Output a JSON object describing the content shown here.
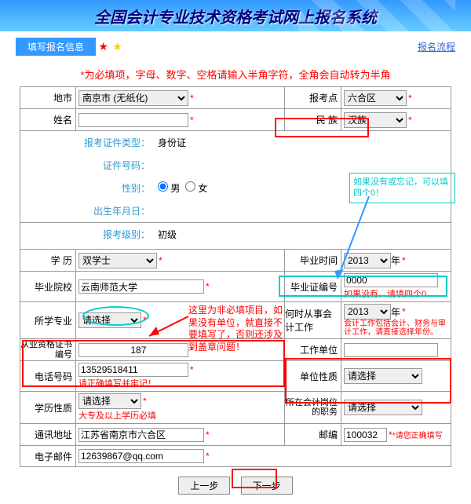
{
  "banner": {
    "title": "全国会计专业技术资格考试网上报名系统"
  },
  "breadcrumb": {
    "label": "填写报名信息",
    "process_link": "报名流程"
  },
  "instruction": "*为必填项，字母、数字、空格请输入半角字符，全角会自动转为半角",
  "form": {
    "region_label": "地市",
    "region_value": "南京市 (无纸化)",
    "exam_point_label": "报考点",
    "exam_point_value": "六合区",
    "name_label": "姓名",
    "name_value": "",
    "ethnic_label": "民 族",
    "ethnic_value": "汉族",
    "id_type_label": "报考证件类型：",
    "id_type_value": "身份证",
    "id_no_label": "证件号码：",
    "id_no_value": "",
    "gender_label": "性别：",
    "gender_m": "男",
    "gender_f": "女",
    "birth_label": "出生年月日：",
    "birth_value": "",
    "exam_level_label": "报考级别：",
    "exam_level_value": "初级",
    "education_label": "学 历",
    "education_value": "双学士",
    "grad_time_label": "毕业时间",
    "grad_time_value": "2013",
    "grad_time_unit": "年",
    "school_label": "毕业院校",
    "school_value": "云南师范大学",
    "cert_no_label": "毕业证编号",
    "cert_no_value": "0000",
    "cert_no_tip": "如果没有，请填四个0",
    "major_label": "所学专业",
    "major_value": "请选择",
    "work_time_label": "何时从事会计工作",
    "work_time_value": "2013",
    "work_time_unit": "年",
    "work_time_tip": "会计工作包括会计、财务与审计工作，请直接选择年份。",
    "qual_cert_label": "从业资格证书编号",
    "qual_cert_value": "                   187",
    "work_unit_label": "工作单位",
    "work_unit_value": "",
    "phone_label": "电话号码",
    "phone_value": "13529518411",
    "phone_tip": "请正确填写并牢记！",
    "unit_type_label": "单位性质",
    "unit_type_value": "请选择",
    "edu_type_label": "学历性质",
    "edu_type_value": "请选择",
    "edu_type_tip": "大专及以上学历必填",
    "position_label": "所在会计岗位的职务",
    "position_value": "请选择",
    "address_label": "通讯地址",
    "address_value": "江苏省南京市六合区",
    "postcode_label": "邮编",
    "postcode_value": "100032",
    "postcode_tip": "*请您正确填写",
    "email_label": "电子邮件",
    "email_value": "12639867@qq.com"
  },
  "annotations": {
    "cert_tip": "如果没有或忘记，可以填四个0！",
    "major_tip": "这里为非必填项目，如果没有单位，就直接不要填写了，否则还涉及到盖章问题！"
  },
  "buttons": {
    "prev": "上一步",
    "next": "下一步"
  }
}
